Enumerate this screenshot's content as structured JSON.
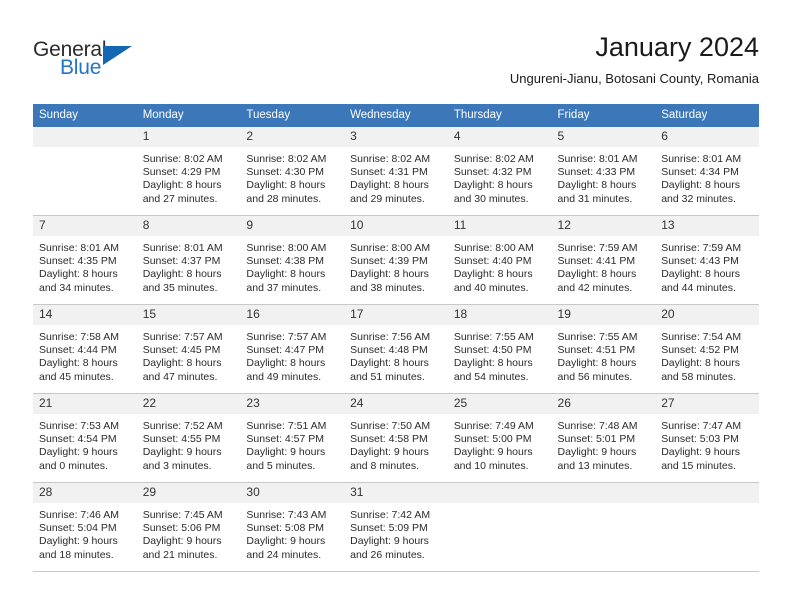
{
  "brand": {
    "name_part1": "General",
    "name_part2": "Blue",
    "accent_color": "#1567b3"
  },
  "header": {
    "title": "January 2024",
    "subtitle": "Ungureni-Jianu, Botosani County, Romania"
  },
  "theme": {
    "header_row_bg": "#3b77b9",
    "daynum_bg": "#f1f1f1",
    "grid_line": "#c8c8c8"
  },
  "weekdays": [
    "Sunday",
    "Monday",
    "Tuesday",
    "Wednesday",
    "Thursday",
    "Friday",
    "Saturday"
  ],
  "weeks": [
    [
      {
        "day": "",
        "lines": [
          "",
          "",
          "",
          ""
        ]
      },
      {
        "day": "1",
        "lines": [
          "Sunrise: 8:02 AM",
          "Sunset: 4:29 PM",
          "Daylight: 8 hours",
          "and 27 minutes."
        ]
      },
      {
        "day": "2",
        "lines": [
          "Sunrise: 8:02 AM",
          "Sunset: 4:30 PM",
          "Daylight: 8 hours",
          "and 28 minutes."
        ]
      },
      {
        "day": "3",
        "lines": [
          "Sunrise: 8:02 AM",
          "Sunset: 4:31 PM",
          "Daylight: 8 hours",
          "and 29 minutes."
        ]
      },
      {
        "day": "4",
        "lines": [
          "Sunrise: 8:02 AM",
          "Sunset: 4:32 PM",
          "Daylight: 8 hours",
          "and 30 minutes."
        ]
      },
      {
        "day": "5",
        "lines": [
          "Sunrise: 8:01 AM",
          "Sunset: 4:33 PM",
          "Daylight: 8 hours",
          "and 31 minutes."
        ]
      },
      {
        "day": "6",
        "lines": [
          "Sunrise: 8:01 AM",
          "Sunset: 4:34 PM",
          "Daylight: 8 hours",
          "and 32 minutes."
        ]
      }
    ],
    [
      {
        "day": "7",
        "lines": [
          "Sunrise: 8:01 AM",
          "Sunset: 4:35 PM",
          "Daylight: 8 hours",
          "and 34 minutes."
        ]
      },
      {
        "day": "8",
        "lines": [
          "Sunrise: 8:01 AM",
          "Sunset: 4:37 PM",
          "Daylight: 8 hours",
          "and 35 minutes."
        ]
      },
      {
        "day": "9",
        "lines": [
          "Sunrise: 8:00 AM",
          "Sunset: 4:38 PM",
          "Daylight: 8 hours",
          "and 37 minutes."
        ]
      },
      {
        "day": "10",
        "lines": [
          "Sunrise: 8:00 AM",
          "Sunset: 4:39 PM",
          "Daylight: 8 hours",
          "and 38 minutes."
        ]
      },
      {
        "day": "11",
        "lines": [
          "Sunrise: 8:00 AM",
          "Sunset: 4:40 PM",
          "Daylight: 8 hours",
          "and 40 minutes."
        ]
      },
      {
        "day": "12",
        "lines": [
          "Sunrise: 7:59 AM",
          "Sunset: 4:41 PM",
          "Daylight: 8 hours",
          "and 42 minutes."
        ]
      },
      {
        "day": "13",
        "lines": [
          "Sunrise: 7:59 AM",
          "Sunset: 4:43 PM",
          "Daylight: 8 hours",
          "and 44 minutes."
        ]
      }
    ],
    [
      {
        "day": "14",
        "lines": [
          "Sunrise: 7:58 AM",
          "Sunset: 4:44 PM",
          "Daylight: 8 hours",
          "and 45 minutes."
        ]
      },
      {
        "day": "15",
        "lines": [
          "Sunrise: 7:57 AM",
          "Sunset: 4:45 PM",
          "Daylight: 8 hours",
          "and 47 minutes."
        ]
      },
      {
        "day": "16",
        "lines": [
          "Sunrise: 7:57 AM",
          "Sunset: 4:47 PM",
          "Daylight: 8 hours",
          "and 49 minutes."
        ]
      },
      {
        "day": "17",
        "lines": [
          "Sunrise: 7:56 AM",
          "Sunset: 4:48 PM",
          "Daylight: 8 hours",
          "and 51 minutes."
        ]
      },
      {
        "day": "18",
        "lines": [
          "Sunrise: 7:55 AM",
          "Sunset: 4:50 PM",
          "Daylight: 8 hours",
          "and 54 minutes."
        ]
      },
      {
        "day": "19",
        "lines": [
          "Sunrise: 7:55 AM",
          "Sunset: 4:51 PM",
          "Daylight: 8 hours",
          "and 56 minutes."
        ]
      },
      {
        "day": "20",
        "lines": [
          "Sunrise: 7:54 AM",
          "Sunset: 4:52 PM",
          "Daylight: 8 hours",
          "and 58 minutes."
        ]
      }
    ],
    [
      {
        "day": "21",
        "lines": [
          "Sunrise: 7:53 AM",
          "Sunset: 4:54 PM",
          "Daylight: 9 hours",
          "and 0 minutes."
        ]
      },
      {
        "day": "22",
        "lines": [
          "Sunrise: 7:52 AM",
          "Sunset: 4:55 PM",
          "Daylight: 9 hours",
          "and 3 minutes."
        ]
      },
      {
        "day": "23",
        "lines": [
          "Sunrise: 7:51 AM",
          "Sunset: 4:57 PM",
          "Daylight: 9 hours",
          "and 5 minutes."
        ]
      },
      {
        "day": "24",
        "lines": [
          "Sunrise: 7:50 AM",
          "Sunset: 4:58 PM",
          "Daylight: 9 hours",
          "and 8 minutes."
        ]
      },
      {
        "day": "25",
        "lines": [
          "Sunrise: 7:49 AM",
          "Sunset: 5:00 PM",
          "Daylight: 9 hours",
          "and 10 minutes."
        ]
      },
      {
        "day": "26",
        "lines": [
          "Sunrise: 7:48 AM",
          "Sunset: 5:01 PM",
          "Daylight: 9 hours",
          "and 13 minutes."
        ]
      },
      {
        "day": "27",
        "lines": [
          "Sunrise: 7:47 AM",
          "Sunset: 5:03 PM",
          "Daylight: 9 hours",
          "and 15 minutes."
        ]
      }
    ],
    [
      {
        "day": "28",
        "lines": [
          "Sunrise: 7:46 AM",
          "Sunset: 5:04 PM",
          "Daylight: 9 hours",
          "and 18 minutes."
        ]
      },
      {
        "day": "29",
        "lines": [
          "Sunrise: 7:45 AM",
          "Sunset: 5:06 PM",
          "Daylight: 9 hours",
          "and 21 minutes."
        ]
      },
      {
        "day": "30",
        "lines": [
          "Sunrise: 7:43 AM",
          "Sunset: 5:08 PM",
          "Daylight: 9 hours",
          "and 24 minutes."
        ]
      },
      {
        "day": "31",
        "lines": [
          "Sunrise: 7:42 AM",
          "Sunset: 5:09 PM",
          "Daylight: 9 hours",
          "and 26 minutes."
        ]
      },
      {
        "day": "",
        "lines": [
          "",
          "",
          "",
          ""
        ]
      },
      {
        "day": "",
        "lines": [
          "",
          "",
          "",
          ""
        ]
      },
      {
        "day": "",
        "lines": [
          "",
          "",
          "",
          ""
        ]
      }
    ]
  ]
}
